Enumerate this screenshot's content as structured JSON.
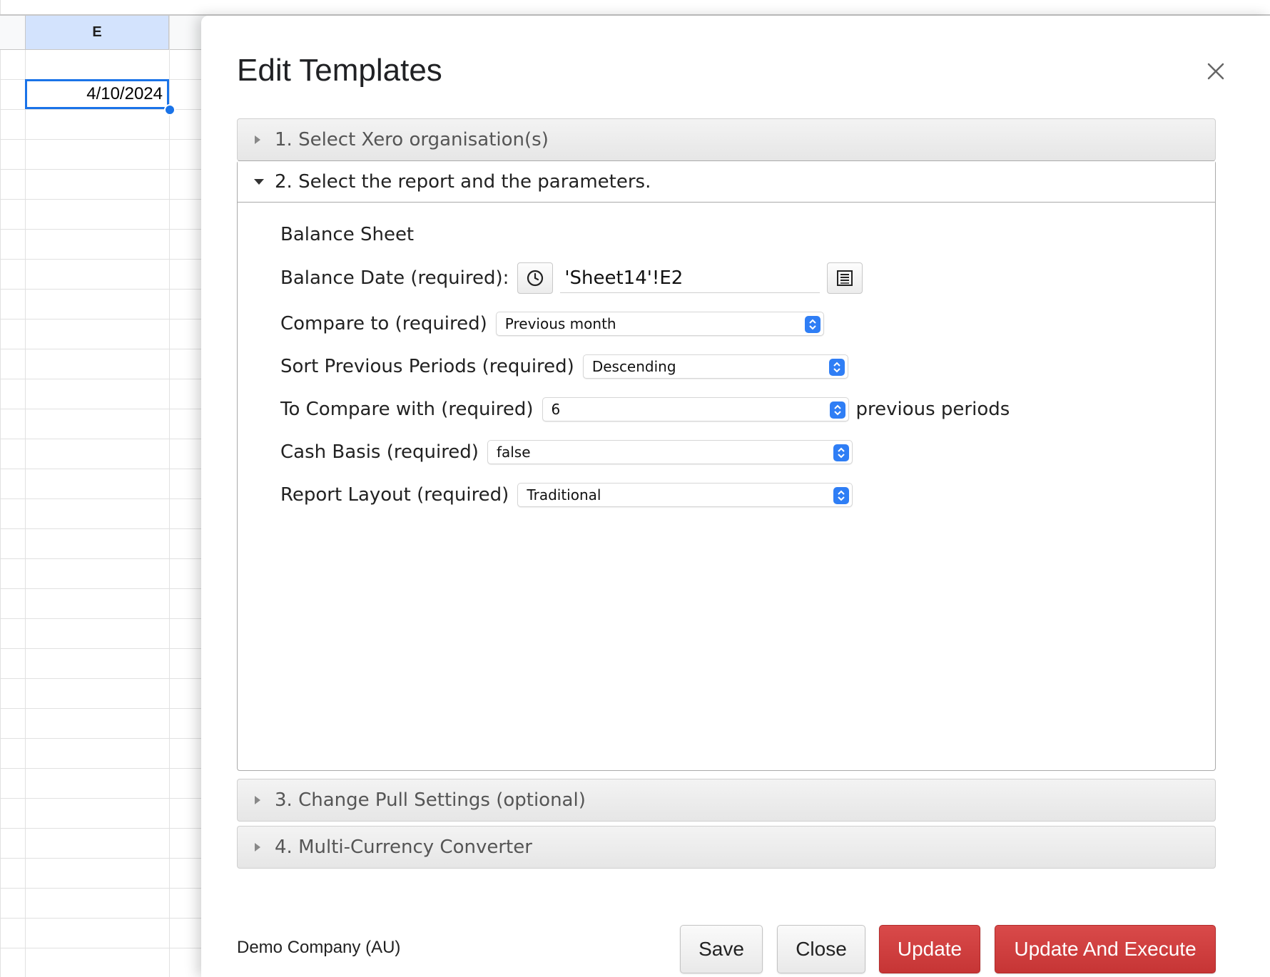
{
  "spreadsheet": {
    "column_header": "E",
    "selected_cell_value": "4/10/2024"
  },
  "dialog": {
    "title": "Edit Templates",
    "sections": [
      {
        "label": "1. Select Xero organisation(s)",
        "expanded": false
      },
      {
        "label": "2. Select the report and the parameters.",
        "expanded": true
      },
      {
        "label": "3. Change Pull Settings (optional)",
        "expanded": false
      },
      {
        "label": "4. Multi-Currency Converter",
        "expanded": false
      }
    ],
    "report": {
      "name": "Balance Sheet",
      "balance_date_label": "Balance Date (required):",
      "balance_date_value": "'Sheet14'!E2",
      "compare_to_label": "Compare to (required)",
      "compare_to_value": "Previous month",
      "sort_label": "Sort Previous Periods (required)",
      "sort_value": "Descending",
      "compare_with_label": "To Compare with (required)",
      "compare_with_value": "6",
      "compare_with_suffix": "previous periods",
      "cash_basis_label": "Cash Basis (required)",
      "cash_basis_value": "false",
      "layout_label": "Report Layout (required)",
      "layout_value": "Traditional"
    },
    "footer": {
      "company": "Demo Company (AU)",
      "save_label": "Save",
      "close_label": "Close",
      "update_label": "Update",
      "update_execute_label": "Update And Execute"
    }
  },
  "icons": {
    "clock": "clock-icon",
    "list": "list-icon",
    "close": "close-icon",
    "chevron": "chevron-up-down-icon"
  },
  "colors": {
    "accent_red": "#c63535",
    "select_spinner": "#2f7ef5",
    "cell_selection": "#1a73e8",
    "column_header_selected": "#d3e3fd"
  }
}
